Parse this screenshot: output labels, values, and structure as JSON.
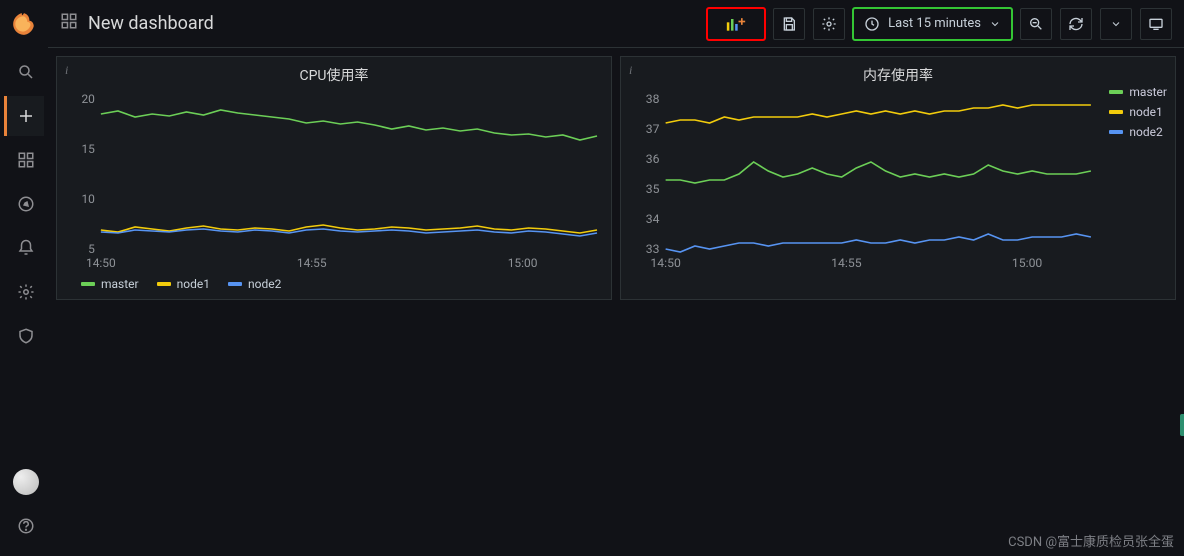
{
  "header": {
    "title": "New dashboard",
    "time_range": "Last 15 minutes"
  },
  "sidebar_icons": [
    "search",
    "plus",
    "dashboards",
    "explore",
    "alert",
    "settings",
    "shield"
  ],
  "panels": {
    "left": {
      "title": "CPU使用率",
      "y_ticks": [
        5,
        10,
        15,
        20
      ],
      "x_ticks": [
        "14:50",
        "14:55",
        "15:00"
      ],
      "series_names": {
        "master": "master",
        "node1": "node1",
        "node2": "node2"
      }
    },
    "right": {
      "title": "内存使用率",
      "y_ticks": [
        33,
        34,
        35,
        36,
        37,
        38
      ],
      "x_ticks": [
        "14:50",
        "14:55",
        "15:00"
      ],
      "series_names": {
        "master": "master",
        "node1": "node1",
        "node2": "node2"
      }
    }
  },
  "series_colors": {
    "master": "#6ccf57",
    "node1": "#f2cc0c",
    "node2": "#5794f2"
  },
  "watermark": "CSDN @富士康质检员张全蛋",
  "chart_data": [
    {
      "type": "line",
      "title": "CPU使用率",
      "xlabel": "",
      "ylabel": "",
      "ylim": [
        5,
        20
      ],
      "x_ticks": [
        "14:50",
        "14:55",
        "15:00"
      ],
      "x": [
        0,
        1,
        2,
        3,
        4,
        5,
        6,
        7,
        8,
        9,
        10,
        11,
        12,
        13,
        14,
        15,
        16,
        17,
        18,
        19,
        20,
        21,
        22,
        23,
        24,
        25,
        26,
        27,
        28,
        29
      ],
      "series": [
        {
          "name": "master",
          "values": [
            18.5,
            18.8,
            18.2,
            18.5,
            18.3,
            18.7,
            18.4,
            18.9,
            18.6,
            18.4,
            18.2,
            18.0,
            17.6,
            17.8,
            17.5,
            17.7,
            17.4,
            17.0,
            17.3,
            16.9,
            17.1,
            16.8,
            17.0,
            16.6,
            16.4,
            16.5,
            16.2,
            16.4,
            15.9,
            16.3
          ]
        },
        {
          "name": "node1",
          "values": [
            6.9,
            6.7,
            7.2,
            7.0,
            6.8,
            7.1,
            7.3,
            7.0,
            6.9,
            7.1,
            7.0,
            6.8,
            7.2,
            7.4,
            7.1,
            6.9,
            7.0,
            7.2,
            7.1,
            6.9,
            7.0,
            7.1,
            7.3,
            7.0,
            6.9,
            7.1,
            7.0,
            6.8,
            6.6,
            6.9
          ]
        },
        {
          "name": "node2",
          "values": [
            6.7,
            6.6,
            6.9,
            6.8,
            6.7,
            6.9,
            7.0,
            6.8,
            6.7,
            6.9,
            6.8,
            6.6,
            6.9,
            7.0,
            6.8,
            6.7,
            6.8,
            6.9,
            6.8,
            6.6,
            6.7,
            6.8,
            6.9,
            6.7,
            6.6,
            6.8,
            6.7,
            6.5,
            6.3,
            6.6
          ]
        }
      ]
    },
    {
      "type": "line",
      "title": "内存使用率",
      "xlabel": "",
      "ylabel": "",
      "ylim": [
        33,
        38
      ],
      "x_ticks": [
        "14:50",
        "14:55",
        "15:00"
      ],
      "x": [
        0,
        1,
        2,
        3,
        4,
        5,
        6,
        7,
        8,
        9,
        10,
        11,
        12,
        13,
        14,
        15,
        16,
        17,
        18,
        19,
        20,
        21,
        22,
        23,
        24,
        25,
        26,
        27,
        28,
        29
      ],
      "series": [
        {
          "name": "master",
          "values": [
            35.3,
            35.3,
            35.2,
            35.3,
            35.3,
            35.5,
            35.9,
            35.6,
            35.4,
            35.5,
            35.7,
            35.5,
            35.4,
            35.7,
            35.9,
            35.6,
            35.4,
            35.5,
            35.4,
            35.5,
            35.4,
            35.5,
            35.8,
            35.6,
            35.5,
            35.6,
            35.5,
            35.5,
            35.5,
            35.6
          ]
        },
        {
          "name": "node1",
          "values": [
            37.2,
            37.3,
            37.3,
            37.2,
            37.4,
            37.3,
            37.4,
            37.4,
            37.4,
            37.4,
            37.5,
            37.4,
            37.5,
            37.6,
            37.5,
            37.6,
            37.5,
            37.6,
            37.5,
            37.6,
            37.6,
            37.7,
            37.7,
            37.8,
            37.7,
            37.8,
            37.8,
            37.8,
            37.8,
            37.8
          ]
        },
        {
          "name": "node2",
          "values": [
            33.0,
            32.9,
            33.1,
            33.0,
            33.1,
            33.2,
            33.2,
            33.1,
            33.2,
            33.2,
            33.2,
            33.2,
            33.2,
            33.3,
            33.2,
            33.2,
            33.3,
            33.2,
            33.3,
            33.3,
            33.4,
            33.3,
            33.5,
            33.3,
            33.3,
            33.4,
            33.4,
            33.4,
            33.5,
            33.4
          ]
        }
      ]
    }
  ]
}
